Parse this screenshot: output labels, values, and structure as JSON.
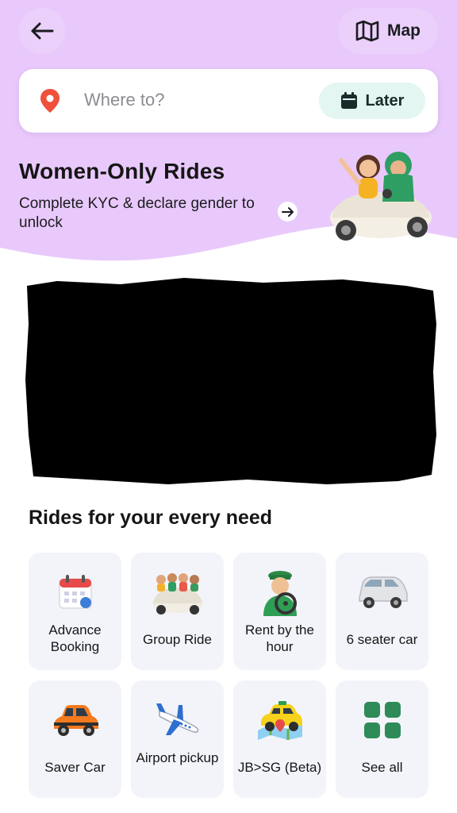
{
  "header": {
    "back_icon": "arrow-left-icon",
    "map_label": "Map",
    "map_icon": "map-icon"
  },
  "search": {
    "placeholder": "Where to?",
    "later_label": "Later",
    "pin_icon": "location-pin-icon",
    "calendar_icon": "calendar-icon"
  },
  "promo": {
    "title": "Women-Only Rides",
    "subtitle": "Complete KYC & declare gender to unlock",
    "arrow_icon": "arrow-right-icon"
  },
  "section": {
    "title": "Rides for your every need"
  },
  "services": [
    {
      "label": "Advance Booking",
      "icon": "calendar-icon"
    },
    {
      "label": "Group Ride",
      "icon": "group-car-icon"
    },
    {
      "label": "Rent by the hour",
      "icon": "driver-icon"
    },
    {
      "label": "6 seater car",
      "icon": "van-icon"
    },
    {
      "label": "Saver Car",
      "icon": "small-car-icon"
    },
    {
      "label": "Airport pickup",
      "icon": "airplane-icon"
    },
    {
      "label": "JB>SG (Beta)",
      "icon": "taxi-map-icon"
    },
    {
      "label": "See all",
      "icon": "grid-icon"
    }
  ],
  "colors": {
    "hero_bg": "#e9c9fb",
    "tile_bg": "#f3f4f9",
    "later_bg": "#e4f6f2",
    "pin": "#f0513c",
    "grid_green": "#2e8b57"
  }
}
